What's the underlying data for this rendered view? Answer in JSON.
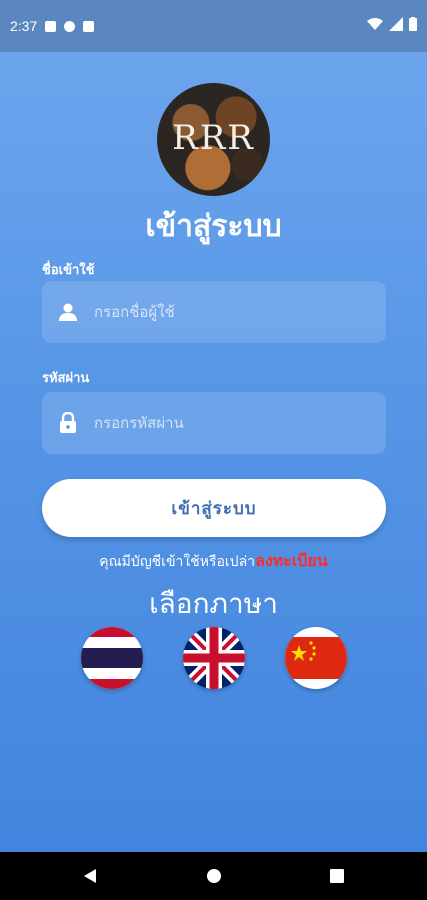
{
  "status_bar": {
    "time": "2:37"
  },
  "logo": {
    "text": "RRR"
  },
  "title": "เข้าสู่ระบบ",
  "username": {
    "label": "ชื่อเข้าใช้",
    "placeholder": "กรอกชื่อผู้ใช้",
    "value": ""
  },
  "password": {
    "label": "รหัสผ่าน",
    "placeholder": "กรอกรหัสผ่าน",
    "value": ""
  },
  "login_button": "เข้าสู่ระบบ",
  "signup": {
    "prompt": "คุณมีบัญชีเข้าใช้หรือเปล่า",
    "link": "ลงทะเบียน"
  },
  "language": {
    "title": "เลือกภาษา",
    "options": [
      {
        "icon": "thailand-flag-icon"
      },
      {
        "icon": "uk-flag-icon"
      },
      {
        "icon": "china-flag-icon"
      }
    ]
  },
  "colors": {
    "accent": "#3f83dd",
    "link": "#ff2b2b",
    "status_bar": "#5b87c0"
  },
  "nav": {
    "icons": [
      "back-icon",
      "home-icon",
      "recents-icon"
    ]
  }
}
